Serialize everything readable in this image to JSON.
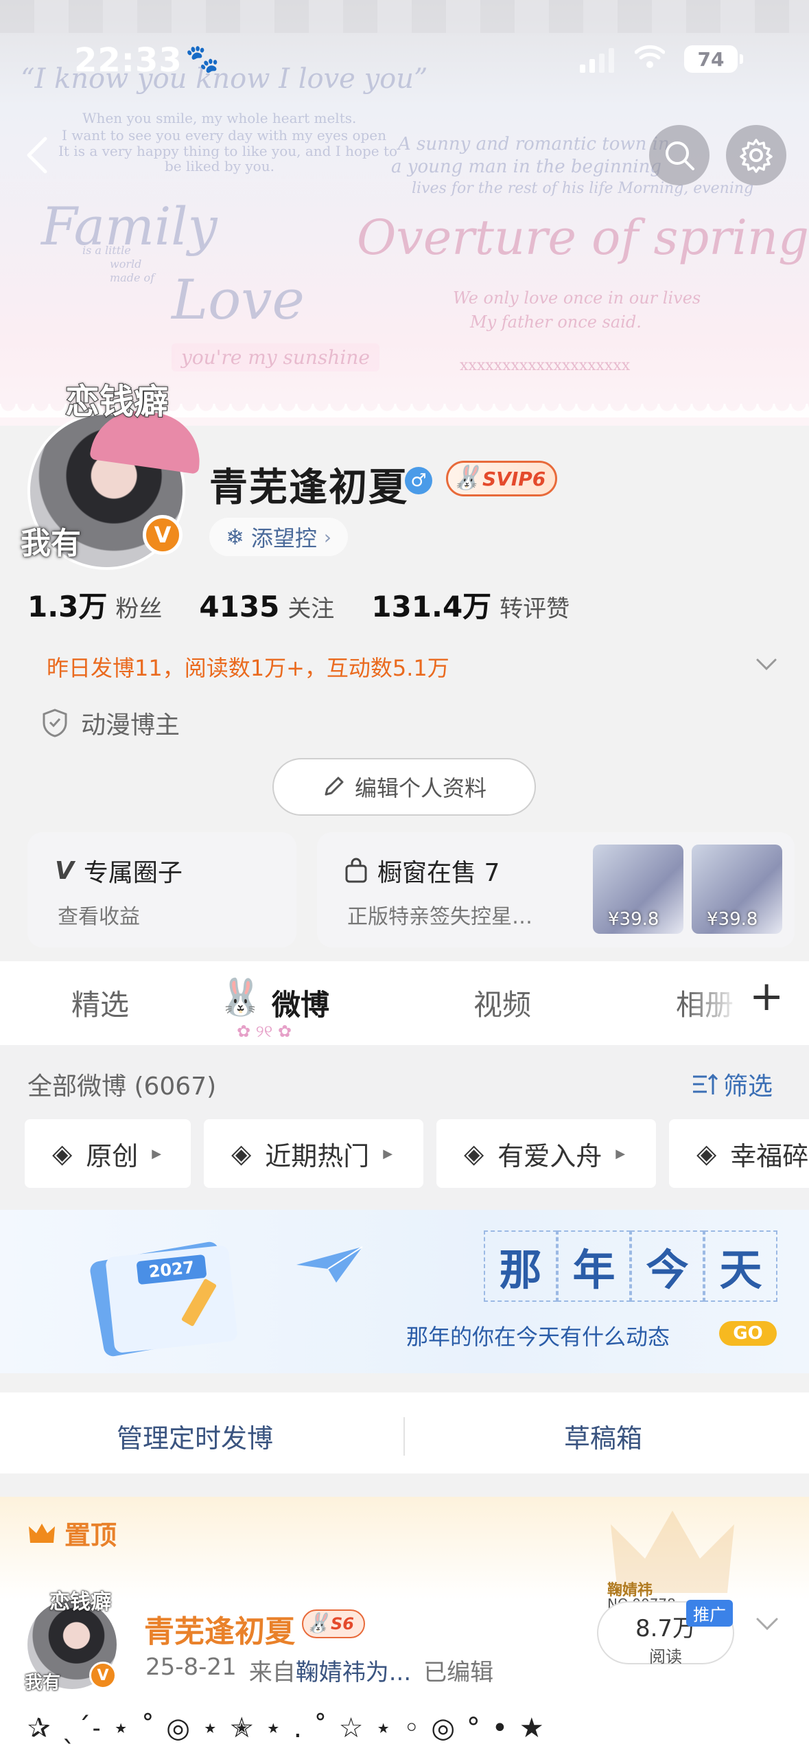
{
  "status_bar": {
    "time": "22:33",
    "battery": "74"
  },
  "banner": {
    "deco_lines": [
      "“I know you know I love you”",
      "When you smile, my whole heart melts.",
      "I want to see you every day with my eyes open",
      "It is a very happy thing to like you, and I hope to",
      "be liked by you.",
      "Family",
      "is a little",
      "world",
      "made of",
      "Love",
      "Overture of spring",
      "A sunny and romantic town in",
      "a young man in the beginning",
      "lives for the rest of his life Morning, evening",
      "We only love once in our lives",
      "My father once said.",
      "you're my sunshine",
      "xxxxxxxxxxxxxxxxxxxx"
    ]
  },
  "profile": {
    "avatar_text_top": "恋钱癖",
    "avatar_text_bottom": "我有",
    "verified": "V",
    "username": "青芜逢初夏",
    "gender": "♂",
    "svip": "SVIP6",
    "fan_club": "添望控",
    "stats": [
      {
        "num": "1.3万",
        "label": "粉丝"
      },
      {
        "num": "4135",
        "label": "关注"
      },
      {
        "num": "131.4万",
        "label": "转评赞"
      }
    ],
    "yesterday": "昨日发博11，阅读数1万+，互动数5.1万",
    "tag": "动漫博主",
    "edit_label": "编辑个人资料"
  },
  "cards": {
    "circle_title": "专属圈子",
    "circle_sub": "查看收益",
    "shop_title": "橱窗在售 7",
    "shop_sub": "正版特亲签失控星…",
    "prices": [
      "¥39.8",
      "¥39.8"
    ]
  },
  "tabs": [
    {
      "label": "精选",
      "active": false
    },
    {
      "label": "微博",
      "active": true
    },
    {
      "label": "视频",
      "active": false
    },
    {
      "label": "相册",
      "active": false
    }
  ],
  "feed_header": {
    "all": "全部微博 (6067)",
    "filter": "筛选"
  },
  "chips": [
    "原创",
    "近期热门",
    "有爱入舟",
    "幸福碎"
  ],
  "nyjt": {
    "chars": [
      "那",
      "年",
      "今",
      "天"
    ],
    "sub": "那年的你在今天有什么动态",
    "go": "GO",
    "calendar_year": "2027"
  },
  "manage": {
    "scheduled": "管理定时发博",
    "drafts": "草稿箱"
  },
  "pinned": {
    "label": "置顶",
    "avatar_text_top": "恋钱癖",
    "avatar_text_bottom": "我有",
    "name": "青芜逢初夏",
    "badge": "S6",
    "date": "25-8-21",
    "from_prefix": "来自",
    "from": "鞠婧祎为...",
    "edited": "已编辑",
    "reads_num": "8.7万",
    "reads_label": "阅读",
    "promo": "推广",
    "promo_label": "鞠婧祎",
    "promo_no": "NO.00778",
    "text": "✰ ˎˊ˗ ⋆ ˚ ◎ ⋆ ✭ ⋆ . ˚ ☆ ⋆ ◦ ◎ ° • ★"
  },
  "colors": {
    "accent_orange": "#ea6a1e",
    "link_blue": "#3b6fb5",
    "vip_red": "#e44a2c"
  }
}
